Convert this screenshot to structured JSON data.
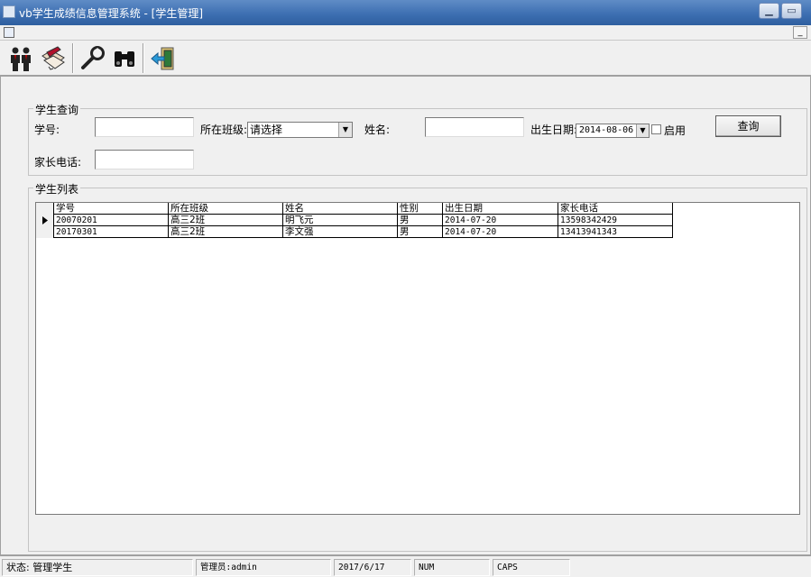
{
  "window": {
    "title": "vb学生成绩信息管理系统 - [学生管理]"
  },
  "toolbar": {
    "buttons": [
      {
        "icon": "people-icon"
      },
      {
        "icon": "edit-document-icon"
      },
      {
        "icon": "wrench-icon"
      },
      {
        "icon": "binoculars-icon"
      },
      {
        "icon": "exit-door-icon"
      }
    ]
  },
  "query": {
    "group_title": "学生查询",
    "student_id_label": "学号:",
    "student_id_value": "",
    "class_label": "所在班级:",
    "class_value": "请选择",
    "name_label": "姓名:",
    "name_value": "",
    "birth_label": "出生日期:",
    "birth_value": "2014-08-06",
    "enable_label": "启用",
    "enable_checked": false,
    "parent_phone_label": "家长电话:",
    "parent_phone_value": "",
    "search_button": "查询"
  },
  "list": {
    "group_title": "学生列表",
    "columns": [
      "学号",
      "所在班级",
      "姓名",
      "性别",
      "出生日期",
      "家长电话"
    ],
    "rows": [
      [
        "20070201",
        "高三2班",
        "明飞元",
        "男",
        "2014-07-20",
        "13598342429"
      ],
      [
        "20170301",
        "高三2班",
        "李文强",
        "男",
        "2014-07-20",
        "13413941343"
      ]
    ],
    "current_row": 0
  },
  "status": {
    "state": "状态: 管理学生",
    "operator": "管理员:admin",
    "date": "2017/6/17",
    "num": "NUM",
    "caps": "CAPS"
  }
}
